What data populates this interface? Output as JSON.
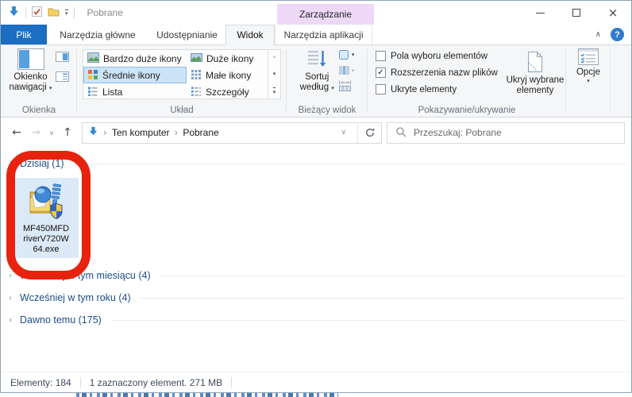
{
  "titlebar": {
    "title": "Pobrane",
    "contextual_header": "Zarządzanie"
  },
  "tabs": {
    "file": "Plik",
    "home": "Narzędzia główne",
    "share": "Udostępnianie",
    "view": "Widok",
    "app_tools": "Narzędzia aplikacji",
    "active": "Widok"
  },
  "glyphs": {
    "caret_down": "▾",
    "scroll_up": "▴",
    "scroll_down": "▾",
    "chevron_up": "∧",
    "chevron_down": "∨",
    "chevron_right": "›",
    "back": "←",
    "forward": "→",
    "up": "↑",
    "check": "✓",
    "help": "?",
    "close": "×"
  },
  "ribbon": {
    "groups": {
      "panes": {
        "label": "Okienka",
        "nav_button": {
          "line1": "Okienko",
          "line2": "nawigacji"
        }
      },
      "layout": {
        "label": "Układ",
        "items": [
          {
            "label": "Bardzo duże ikony",
            "selected": false
          },
          {
            "label": "Duże ikony",
            "selected": false
          },
          {
            "label": "Średnie ikony",
            "selected": true
          },
          {
            "label": "Małe ikony",
            "selected": false
          },
          {
            "label": "Lista",
            "selected": false
          },
          {
            "label": "Szczegóły",
            "selected": false
          }
        ]
      },
      "current_view": {
        "label": "Bieżący widok",
        "sort_button": {
          "line1": "Sortuj",
          "line2": "według"
        }
      },
      "show_hide": {
        "label": "Pokazywanie/ukrywanie",
        "checkboxes": [
          {
            "label": "Pola wyboru elementów",
            "checked": false
          },
          {
            "label": "Rozszerzenia nazw plików",
            "checked": true
          },
          {
            "label": "Ukryte elementy",
            "checked": false
          }
        ],
        "hide_button": {
          "line1": "Ukryj wybrane",
          "line2": "elementy"
        }
      },
      "options": {
        "button_label": "Opcje"
      }
    }
  },
  "navbar": {
    "breadcrumb": {
      "root": "Ten komputer",
      "current": "Pobrane"
    },
    "search_placeholder": "Przeszukaj: Pobrane"
  },
  "content": {
    "groups": [
      {
        "chevron": "∨",
        "label": "Dzisiaj (1)",
        "expanded": true
      },
      {
        "chevron": "›",
        "label": "Wcześniej w tym miesiącu (4)",
        "expanded": false
      },
      {
        "chevron": "›",
        "label": "Wcześniej w tym roku (4)",
        "expanded": false
      },
      {
        "chevron": "›",
        "label": "Dawno temu (175)",
        "expanded": false
      }
    ],
    "file": {
      "name": "MF450MFDriverV720W64.exe",
      "name_lines": [
        "MF450MFD",
        "riverV720W",
        "64.exe"
      ],
      "selected": true
    }
  },
  "statusbar": {
    "items_count": "Elementy: 184",
    "selection_info": "1 zaznaczony element. 271 MB"
  },
  "annotation": {
    "shape": "rounded-rect",
    "color": "#e8230d"
  },
  "colors": {
    "accent_blue": "#1b6ec2",
    "contextual_purple": "#eed8f7",
    "selection_blue": "#cce4f7",
    "group_header_blue": "#1d4e89",
    "annotation_red": "#e8230d"
  }
}
